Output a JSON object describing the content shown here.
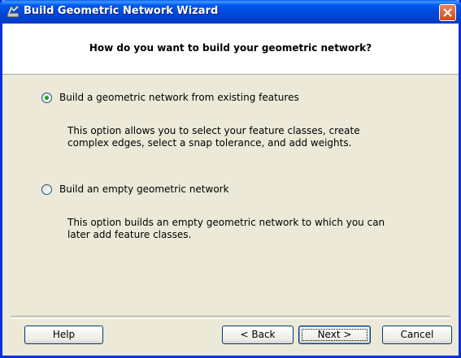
{
  "window": {
    "title": "Build Geometric Network Wizard"
  },
  "header": {
    "question": "How do you want to build your geometric network?"
  },
  "options": [
    {
      "label": "Build a geometric network from existing features",
      "selected": true,
      "description_lines": [
        "This option allows you to select your feature classes, create",
        "complex edges, select a snap tolerance, and add weights."
      ]
    },
    {
      "label": "Build an empty geometric network",
      "selected": false,
      "description_lines": [
        "This option builds an empty geometric network to which you can",
        "later add feature classes."
      ]
    }
  ],
  "buttons": {
    "help": "Help",
    "back": "< Back",
    "next": "Next >",
    "cancel": "Cancel"
  },
  "colors": {
    "titlebar": "#0054e3",
    "face": "#ece9d8",
    "radio_dot": "#21a121",
    "close": "#d2491e"
  }
}
